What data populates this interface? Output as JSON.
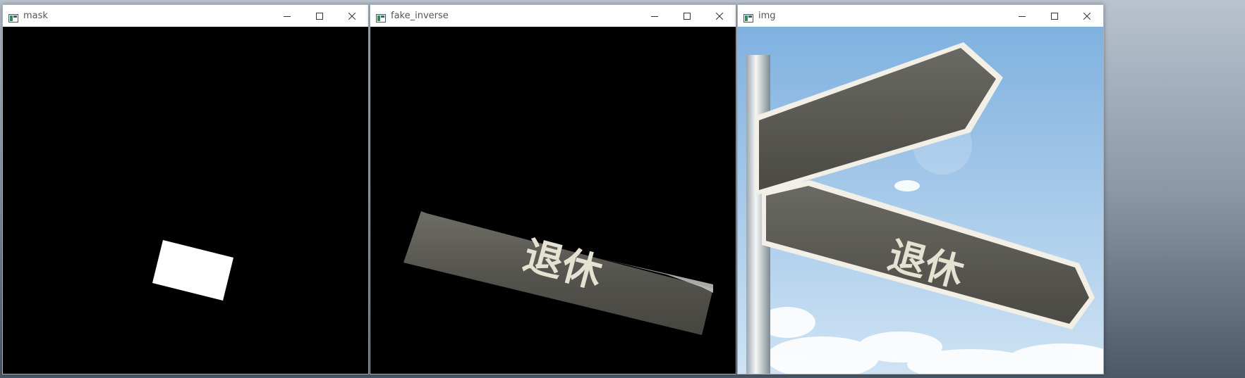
{
  "windows": [
    {
      "title": "mask"
    },
    {
      "title": "fake_inverse",
      "sign_text": "退休"
    },
    {
      "title": "img",
      "sign_text": "退休"
    }
  ],
  "colors": {
    "sky_top": "#7fb1e0",
    "sky_bottom": "#cfe3f4",
    "sign_wood": "#5a5a55",
    "sign_text": "#e6e2d2"
  },
  "icons": {
    "app": "window-app-icon",
    "minimize": "minimize-icon",
    "maximize": "maximize-icon",
    "close": "close-icon"
  }
}
